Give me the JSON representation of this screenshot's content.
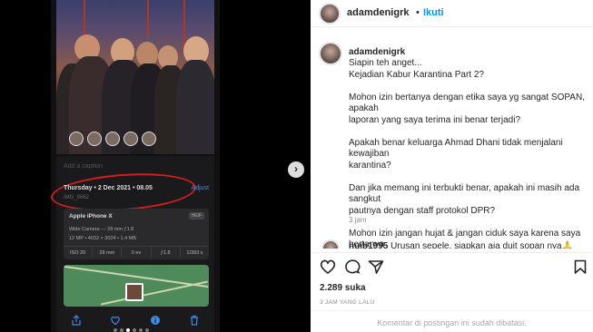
{
  "photo_screen": {
    "add_caption": "Add a caption",
    "date": "Thursday • 2 Dec 2021 • 08.05",
    "adjust": "Adjust",
    "filename": "IMG_8662",
    "camera": {
      "name": "Apple iPhone X",
      "format": "HEIF",
      "lens": "Wide Camera — 28 mm ƒ1.8",
      "specs": "12 MP • 4032 × 3024 • 1,4 MB",
      "exif": [
        "ISO 20",
        "28 mm",
        "0 ev",
        "ƒ1.8",
        "1/393 s"
      ]
    },
    "bottom_icons": [
      "share-icon",
      "heart-icon",
      "info-icon",
      "trash-icon"
    ],
    "accent_color": "#3d8ce8",
    "highlight_color": "#d21e1e"
  },
  "post": {
    "username": "adamdenigrk",
    "separator": "•",
    "follow_label": "Ikuti",
    "caption_user": "adamdenigrk",
    "caption_text": "Siapin teh anget...\nKejadian Kabur Karantina Part 2?\n\nMohon izin bertanya dengan etika saya yg sangat SOPAN, apakah\nlaporan yang saya terima ini benar terjadi?\n\nApakah benar keluarga Ahmad Dhani tidak menjalani kewajiban\nkarantina?\n\nDan jika memang ini terbukti benar, apakah ini masih ada sangkut\npautnya dengan staff protokol DPR?\n\nMohon izin jangan hujat & jangan ciduk saya karena saya bertanya\ndengan sangat SOPAN.🙏",
    "caption_time": "3 jam",
    "comment_user": "nujb1995",
    "comment_text": "Urusan sepele, siapkan aja duit sopan nya🙏",
    "likes": "2.289 suka",
    "time_ago": "3 JAM YANG LALU",
    "comments_disabled": "Komentar di postingan ini sudah dibatasi."
  }
}
